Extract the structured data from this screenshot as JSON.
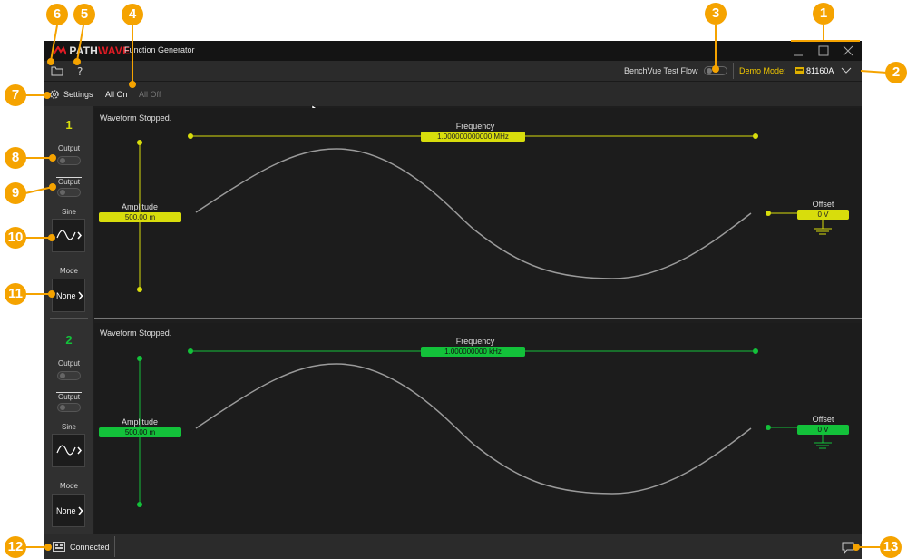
{
  "app": {
    "logo_brand_a": "PATH",
    "logo_brand_b": "WAVE",
    "title": "Function Generator"
  },
  "toolbar": {
    "benchvue_label": "BenchVue Test Flow",
    "demo_label": "Demo Mode:",
    "instrument": "81160A",
    "settings_label": "Settings",
    "all_on": "All On",
    "all_off": "All Off"
  },
  "channels": [
    {
      "number": "1",
      "color": "#d8dd0c",
      "status": "Waveform Stopped.",
      "output_label": "Output",
      "output_inv_label": "Output",
      "waveform_label": "Sine",
      "mode_label": "Mode",
      "mode_value": "None",
      "frequency_label": "Frequency",
      "frequency_value": "1.000000000000 MHz",
      "amplitude_label": "Amplitude",
      "amplitude_value": "500.00 m",
      "offset_label": "Offset",
      "offset_value": "0 V"
    },
    {
      "number": "2",
      "color": "#13c13a",
      "status": "Waveform Stopped.",
      "output_label": "Output",
      "output_inv_label": "Output",
      "waveform_label": "Sine",
      "mode_label": "Mode",
      "mode_value": "None",
      "frequency_label": "Frequency",
      "frequency_value": "1.000000000 kHz",
      "amplitude_label": "Amplitude",
      "amplitude_value": "500.00 m",
      "offset_label": "Offset",
      "offset_value": "0 V"
    }
  ],
  "statusbar": {
    "connection": "Connected"
  },
  "callouts": [
    "1",
    "2",
    "3",
    "4",
    "5",
    "6",
    "7",
    "8",
    "9",
    "10",
    "11",
    "12",
    "13"
  ]
}
